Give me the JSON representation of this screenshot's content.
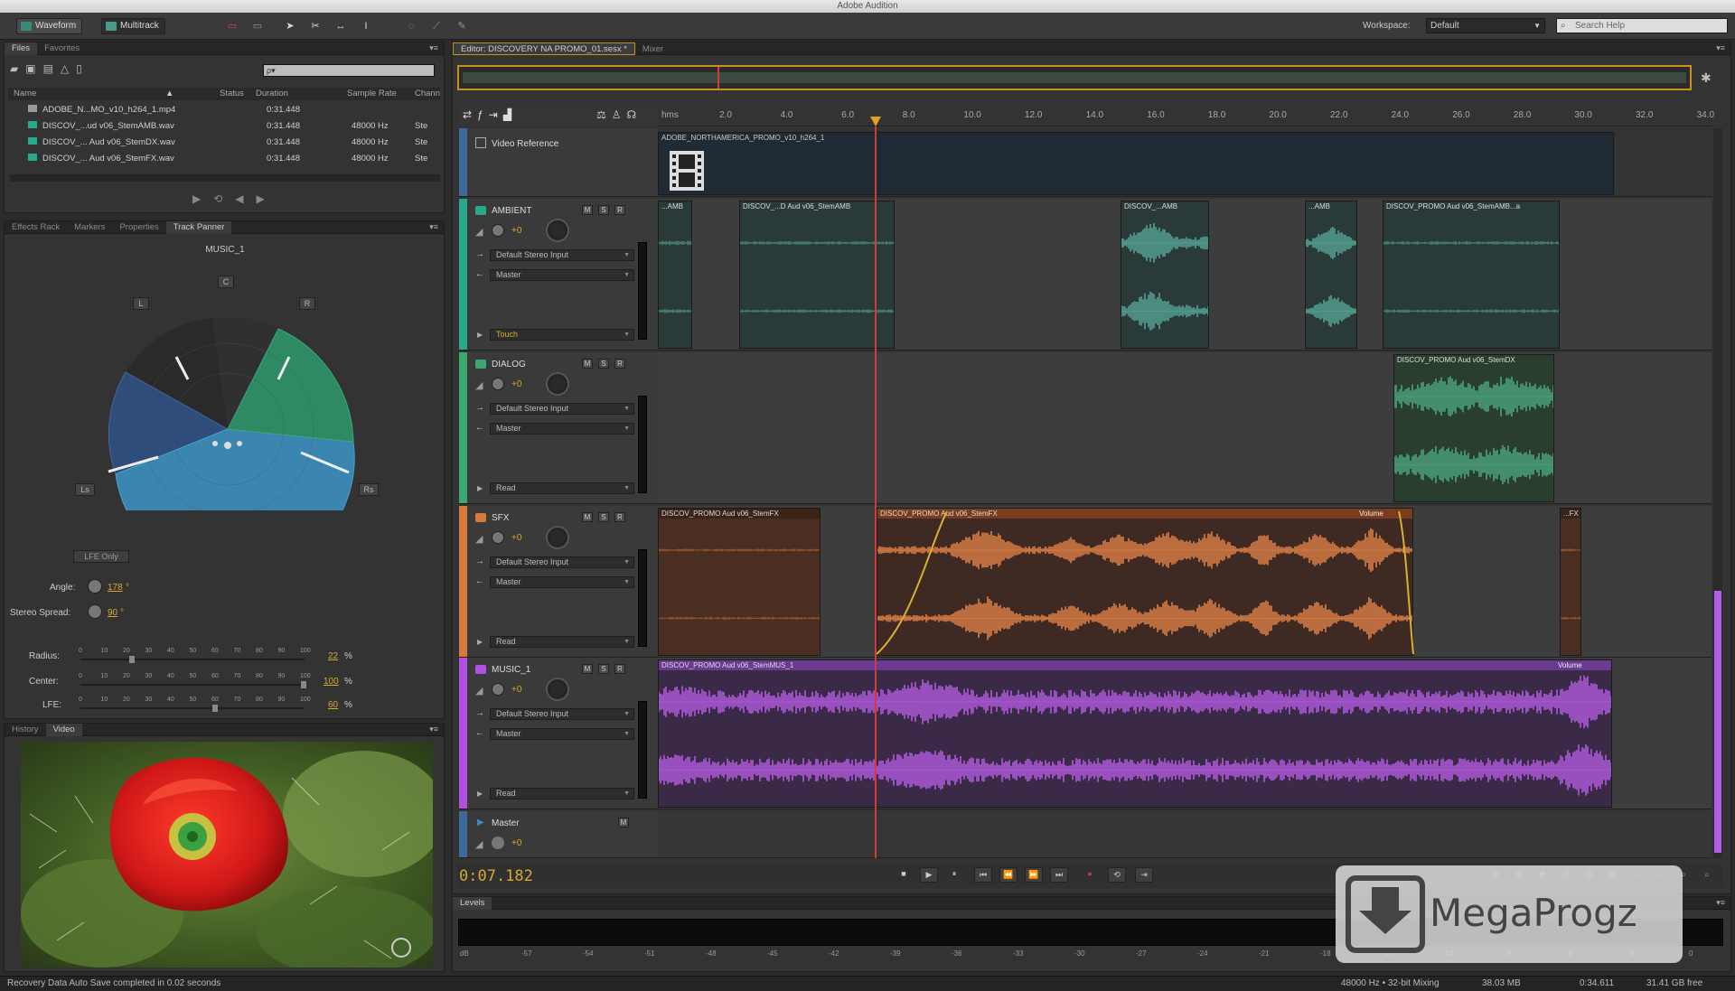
{
  "app_title": "Adobe Audition",
  "toolbar": {
    "waveform_label": "Waveform",
    "multitrack_label": "Multitrack",
    "workspace_label": "Workspace:",
    "workspace_value": "Default",
    "search_help": "Search Help"
  },
  "files_panel": {
    "tabs": [
      "Files",
      "Favorites"
    ],
    "search_placeholder": "ρ▾",
    "columns": [
      "Name",
      "Status",
      "Duration",
      "Sample Rate",
      "Chann"
    ],
    "files": [
      {
        "name": "ADOBE_N...MO_v10_h264_1.mp4",
        "duration": "0:31.448",
        "rate": "",
        "ch": ""
      },
      {
        "name": "DISCOV_...ud v06_StemAMB.wav",
        "duration": "0:31.448",
        "rate": "48000 Hz",
        "ch": "Ste"
      },
      {
        "name": "DISCOV_... Aud v06_StemDX.wav",
        "duration": "0:31.448",
        "rate": "48000 Hz",
        "ch": "Ste"
      },
      {
        "name": "DISCOV_... Aud v06_StemFX.wav",
        "duration": "0:31.448",
        "rate": "48000 Hz",
        "ch": "Ste"
      }
    ]
  },
  "panner_panel": {
    "tabs": [
      "Effects Rack",
      "Markers",
      "Properties",
      "Track Panner"
    ],
    "track_name": "MUSIC_1",
    "speakers": {
      "c": "C",
      "l": "L",
      "r": "R",
      "ls": "Ls",
      "rs": "Rs"
    },
    "lfe_only": "LFE Only",
    "angle_label": "Angle:",
    "angle_value": "178",
    "angle_unit": "°",
    "spread_label": "Stereo Spread:",
    "spread_value": "90",
    "spread_unit": "°",
    "scale_ticks": [
      "0",
      "10",
      "20",
      "30",
      "40",
      "50",
      "60",
      "70",
      "80",
      "90",
      "100"
    ],
    "sliders": [
      {
        "label": "Radius:",
        "value": "22",
        "unit": "%",
        "level": 0.22
      },
      {
        "label": "Center:",
        "value": "100",
        "unit": "%",
        "level": 1.0
      },
      {
        "label": "LFE:",
        "value": "60",
        "unit": "%",
        "level": 0.6
      }
    ]
  },
  "video_panel": {
    "tabs": [
      "History",
      "Video"
    ]
  },
  "editor": {
    "tabs": [
      "Editor: DISCOVERY NA PROMO_01.sesx *",
      "Mixer"
    ],
    "ruler_unit": "hms",
    "ruler_ticks": [
      "2.0",
      "4.0",
      "6.0",
      "8.0",
      "10.0",
      "12.0",
      "14.0",
      "16.0",
      "18.0",
      "20.0",
      "22.0",
      "24.0",
      "26.0",
      "28.0",
      "30.0",
      "32.0",
      "34.0"
    ],
    "video_track": {
      "name": "Video Reference",
      "clip": "ADOBE_NORTHAMERICA_PROMO_v10_h264_1"
    },
    "tracks": [
      {
        "name": "AMBIENT",
        "vol": "+0",
        "input": "Default Stereo Input",
        "output": "Master",
        "mode": "Touch",
        "color": "#2aa88a",
        "clips": [
          "...AMB",
          "DISCOV_...D Aud v06_StemAMB",
          "DISCOV_...AMB",
          "...AMB",
          "DISCOV_PROMO Aud v06_StemAMB...a"
        ]
      },
      {
        "name": "DIALOG",
        "vol": "+0",
        "input": "Default Stereo Input",
        "output": "Master",
        "mode": "Read",
        "color": "#3aa870",
        "clips": [
          "DISCOV_PROMO Aud v06_StemDX"
        ]
      },
      {
        "name": "SFX",
        "vol": "+0",
        "input": "Default Stereo Input",
        "output": "Master",
        "mode": "Read",
        "color": "#d87a3a",
        "clips": [
          "DISCOV_PROMO Aud v06_StemFX",
          "DISCOV_PROMO Aud v06_StemFX",
          "Volume",
          "...FX"
        ]
      },
      {
        "name": "MUSIC_1",
        "vol": "+0",
        "input": "Default Stereo Input",
        "output": "Master",
        "mode": "Read",
        "color": "#b050e0",
        "clips": [
          "DISCOV_PROMO Aud v06_StemMUS_1",
          "Volume"
        ]
      }
    ],
    "master": {
      "name": "Master",
      "vol": "+0"
    },
    "time_display": "0:07.182"
  },
  "levels_panel": {
    "tab": "Levels",
    "scale": [
      "dB",
      "-57",
      "-54",
      "-51",
      "-48",
      "-45",
      "-42",
      "-39",
      "-36",
      "-33",
      "-30",
      "-27",
      "-24",
      "-21",
      "-18",
      "-15",
      "-12",
      "-9",
      "-6",
      "-3",
      "0"
    ]
  },
  "watermark": "MegaProgz",
  "statusbar": {
    "left": "Recovery Data Auto Save completed in 0.02 seconds",
    "format": "48000 Hz • 32-bit Mixing",
    "size": "38.03 MB",
    "duration": "0:34.611",
    "free": "31.41 GB free"
  },
  "colors": {
    "ambient": "#2aa88a",
    "dialog": "#3aa870",
    "sfx": "#e8894a",
    "music": "#b45ae8",
    "playhead": "#d33b3b",
    "accent": "#d8a830"
  }
}
